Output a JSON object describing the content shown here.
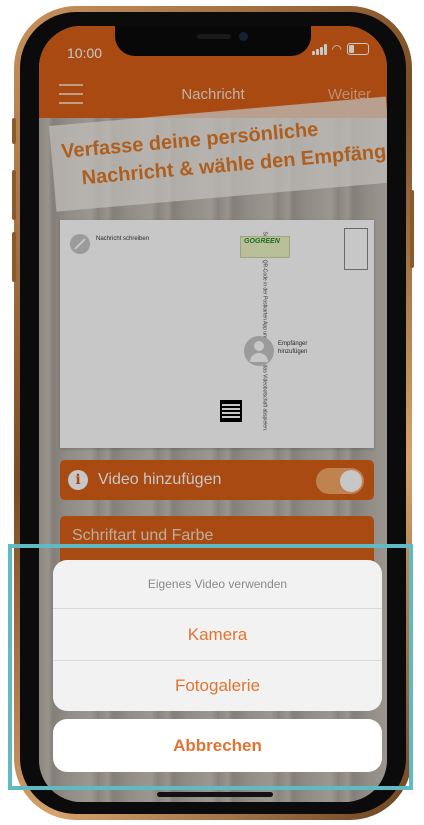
{
  "status_bar": {
    "time": "10:00"
  },
  "nav": {
    "title": "Nachricht",
    "next_label": "Weiter"
  },
  "banner": {
    "line1": "Verfasse deine persönliche",
    "line2": "Nachricht & wähle den Empfänger"
  },
  "postcard": {
    "message_label": "Nachricht schreiben",
    "recipient_label_line1": "Empfänger",
    "recipient_label_line2": "hinzufügen",
    "gogreen_label": "GOGREEN",
    "vertical_text": "Scanne den QR-Code in der Postkarten App und lasse dich das Videobotschaft abspielen."
  },
  "video_row": {
    "label": "Video hinzufügen",
    "toggle_on": true
  },
  "font_row": {
    "label": "Schriftart und Farbe"
  },
  "action_sheet": {
    "title": "Eigenes Video verwenden",
    "options": [
      "Kamera",
      "Fotogalerie"
    ],
    "cancel_label": "Abbrechen"
  },
  "colors": {
    "accent": "#d85f16",
    "action_text": "#e27432",
    "highlight": "#5fbac4"
  }
}
